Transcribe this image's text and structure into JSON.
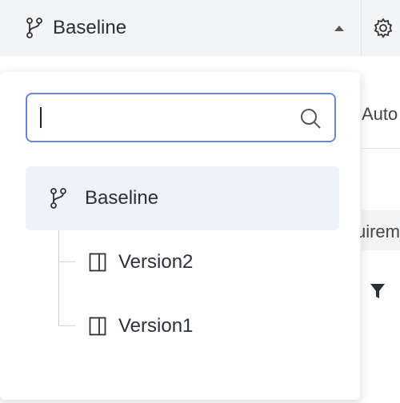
{
  "header": {
    "branch_label": "Baseline",
    "branch_icon": "branch-icon",
    "caret_icon": "caret-up-icon",
    "settings_icon": "gear-icon"
  },
  "background": {
    "partial_text_1": "Auto",
    "partial_text_2": "uirem",
    "filter_icon": "filter-icon"
  },
  "dropdown": {
    "search": {
      "value": "",
      "placeholder": "",
      "icon": "search-icon"
    },
    "tree": {
      "root": {
        "label": "Baseline",
        "icon": "branch-icon",
        "selected": true
      },
      "children": [
        {
          "label": "Version2",
          "icon": "panel-icon"
        },
        {
          "label": "Version1",
          "icon": "panel-icon"
        }
      ]
    }
  },
  "colors": {
    "accent": "#6b86d6",
    "selected_bg": "#edf1fa",
    "topbar_bg": "#f3f4f6"
  }
}
